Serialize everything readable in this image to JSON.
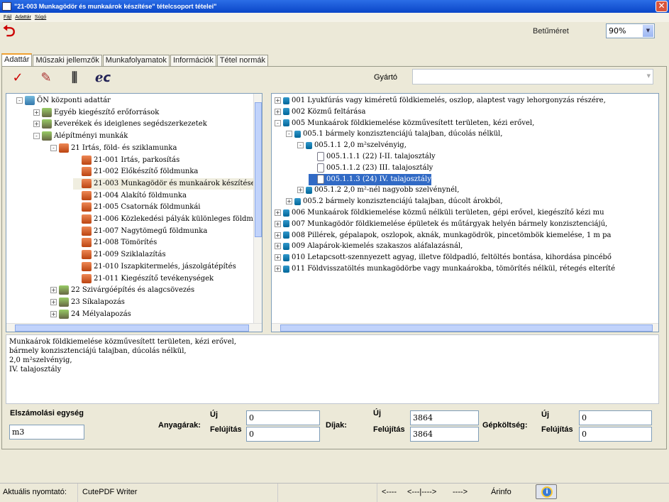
{
  "window": {
    "title": "\"21-003 Munkagödör és munkaárok készítése\" tételcsoport tételei\"",
    "close": "✕"
  },
  "menu": [
    "Fájl",
    "Adattár",
    "Súgó"
  ],
  "toolbar": {
    "back_icon": "back-arrow-icon",
    "font_label": "Betűméret",
    "font_value": "90%"
  },
  "tabs": [
    "Adattár",
    "Műszaki jellemzők",
    "Munkafolyamatok",
    "Információk",
    "Tétel normák"
  ],
  "tools": [
    {
      "icon": "checkmark-icon",
      "glyph": "✓"
    },
    {
      "icon": "edit-icon",
      "glyph": "✎"
    },
    {
      "icon": "chart-icon",
      "glyph": "⫼"
    },
    {
      "icon": "browser-icon",
      "glyph": "e"
    }
  ],
  "gyarto": {
    "label": "Gyártó",
    "value": ""
  },
  "left_tree": [
    {
      "label": "ÖN központi adattár",
      "exp": "-",
      "icon": "fold"
    },
    {
      "label": "Egyéb kiegészítő erőforrások",
      "exp": "+",
      "icon": "house"
    },
    {
      "label": "Keverékek és ideiglenes segédszerkezetek",
      "exp": "+",
      "icon": "house"
    },
    {
      "label": "Alépítményi munkák",
      "exp": "-",
      "icon": "house"
    },
    {
      "label": "21 Irtás, föld- és sziklamunka",
      "exp": "-",
      "icon": "brick"
    },
    {
      "label": "21-001 Irtás, parkosítás",
      "exp": "",
      "icon": "brick"
    },
    {
      "label": "21-002 Előkészítő földmunka",
      "exp": "",
      "icon": "brick"
    },
    {
      "label": "21-003 Munkagödör és munkaárok készítése",
      "exp": "",
      "icon": "brick"
    },
    {
      "label": "21-004 Alakító földmunka",
      "exp": "",
      "icon": "brick"
    },
    {
      "label": "21-005 Csatornák földmunkái",
      "exp": "",
      "icon": "brick"
    },
    {
      "label": "21-006 Közlekedési pályák különleges földmu",
      "exp": "",
      "icon": "brick"
    },
    {
      "label": "21-007 Nagytömegű földmunka",
      "exp": "",
      "icon": "brick"
    },
    {
      "label": "21-008 Tömörítés",
      "exp": "",
      "icon": "brick"
    },
    {
      "label": "21-009 Sziklalazítás",
      "exp": "",
      "icon": "brick"
    },
    {
      "label": "21-010 Iszapkitermelés, jászolgátépítés",
      "exp": "",
      "icon": "brick"
    },
    {
      "label": "21-011 Kiegészítő tevékenységek",
      "exp": "",
      "icon": "brick"
    },
    {
      "label": "22 Szivárgóépítés és alagcsövezés",
      "exp": "+",
      "icon": "house"
    },
    {
      "label": "23 Síkalapozás",
      "exp": "+",
      "icon": "house"
    },
    {
      "label": "24 Mélyalapozás",
      "exp": "+",
      "icon": "house"
    }
  ],
  "right_tree": [
    {
      "label": "001 Lyukfúrás vagy kiméretű földkiemelés, oszlop, alaptest vagy lehorgonyzás részére,",
      "exp": "+",
      "icon": "sm"
    },
    {
      "label": "002 Közmű feltárása",
      "exp": "+",
      "icon": "sm"
    },
    {
      "label": "005 Munkaárok földkiemelése közművesített területen, kézi erővel,",
      "exp": "-",
      "icon": "sm"
    },
    {
      "label": "005.1 bármely konzisztenciájú talajban, dúcolás nélkül,",
      "exp": "-",
      "icon": "sm"
    },
    {
      "label": "005.1.1 2,0 m²szelvényig,",
      "exp": "-",
      "icon": "sm"
    },
    {
      "label": "005.1.1.1 (22) I-II. talajosztály",
      "exp": "",
      "icon": "doc"
    },
    {
      "label": "005.1.1.2 (23) III. talajosztály",
      "exp": "",
      "icon": "doc"
    },
    {
      "label": "005.1.1.3 (24) IV. talajosztály",
      "exp": "",
      "icon": "doc"
    },
    {
      "label": "005.1.2 2,0 m²-nél nagyobb szelvénynél,",
      "exp": "+",
      "icon": "sm"
    },
    {
      "label": "005.2 bármely konzisztenciájú talajban, dúcolt árokból,",
      "exp": "+",
      "icon": "sm"
    },
    {
      "label": "006 Munkaárok földkiemelése közmű nélküli területen, gépi erővel, kiegészítő kézi mu",
      "exp": "+",
      "icon": "sm"
    },
    {
      "label": "007 Munkagödör földkiemelése épületek és műtárgyak helyén bármely konzisztenciájú,",
      "exp": "+",
      "icon": "sm"
    },
    {
      "label": "008 Pillérek, gépalapok, oszlopok, aknák, munkagödrök, pincetömbök kiemelése, 1 m pa",
      "exp": "+",
      "icon": "sm"
    },
    {
      "label": "009 Alapárok-kiemelés szakaszos aláfalazásnál,",
      "exp": "+",
      "icon": "sm"
    },
    {
      "label": "010 Letapcsott-szennyezett agyag, illetve földpadló, feltöltés bontása, kihordása pincébő",
      "exp": "+",
      "icon": "sm"
    },
    {
      "label": "011 Földvisszatöltés munkagödörbe vagy munkaárokba, tömörítés nélkül, rétegés elteríté",
      "exp": "+",
      "icon": "sm"
    }
  ],
  "description": [
    "Munkaárok földkiemelése közművesített területen, kézi erővel,",
    "bármely konzisztenciájú talajban, dúcolás nélkül,",
    "2,0 m²szelvényig,",
    "IV. talajosztály"
  ],
  "fields": {
    "elsz_label": "Elszámolási egység",
    "elsz_value": "m3",
    "anyag_label": "Anyagárak:",
    "dij_label": "Díjak:",
    "gep_label": "Gépköltség:",
    "uj": "Új",
    "felujitas": "Felújítás",
    "anyag_uj": "0",
    "anyag_fel": "0",
    "dij_uj": "3864",
    "dij_fel": "3864",
    "gep_uj": "0",
    "gep_fel": "0"
  },
  "status": {
    "printer_label": "Aktuális nyomtató:",
    "printer": "CutePDF Writer",
    "nav1": "<----",
    "nav2": "<---|---->",
    "nav3": "---->",
    "arinfo": "Árinfo",
    "info_icon": "info-icon"
  }
}
